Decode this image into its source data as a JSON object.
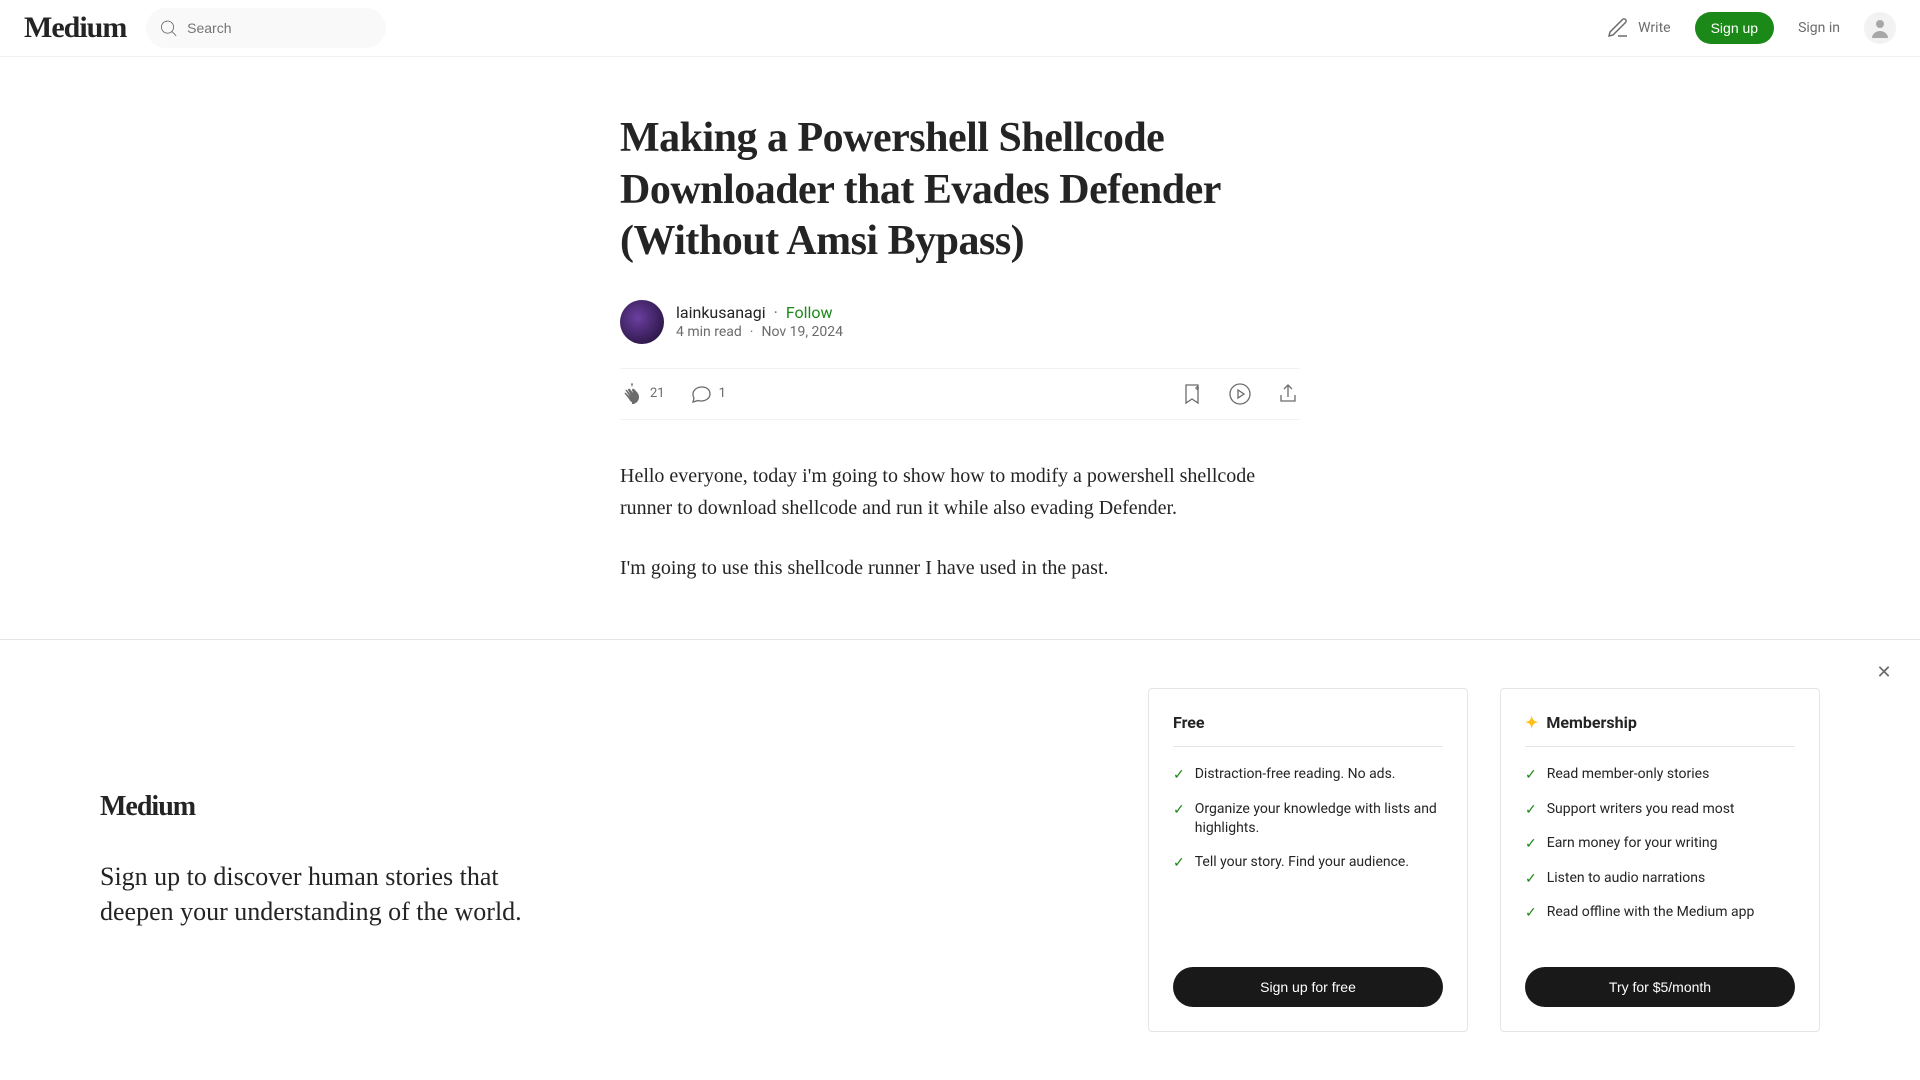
{
  "header": {
    "search_placeholder": "Search",
    "write_label": "Write",
    "signup_label": "Sign up",
    "signin_label": "Sign in"
  },
  "article": {
    "title": "Making a Powershell Shellcode Downloader that Evades Defender (Without Amsi Bypass)",
    "author_name": "lainkusanagi",
    "follow_label": "Follow",
    "read_time": "4 min read",
    "date": "Nov 19, 2024",
    "clap_count": "21",
    "comment_count": "1",
    "paragraphs": [
      "Hello everyone, today i'm going to show how to modify a powershell shellcode runner to download shellcode and run it while also evading Defender.",
      "I'm going to use this shellcode runner I have used in the past."
    ]
  },
  "promo": {
    "brand": "Medium",
    "tagline": "Sign up to discover human stories that deepen your understanding of the world.",
    "free": {
      "title": "Free",
      "items": [
        "Distraction-free reading. No ads.",
        "Organize your knowledge with lists and highlights.",
        "Tell your story. Find your audience."
      ],
      "cta": "Sign up for free"
    },
    "membership": {
      "title": "Membership",
      "items": [
        "Read member-only stories",
        "Support writers you read most",
        "Earn money for your writing",
        "Listen to audio narrations",
        "Read offline with the Medium app"
      ],
      "cta": "Try for $5/month"
    }
  }
}
